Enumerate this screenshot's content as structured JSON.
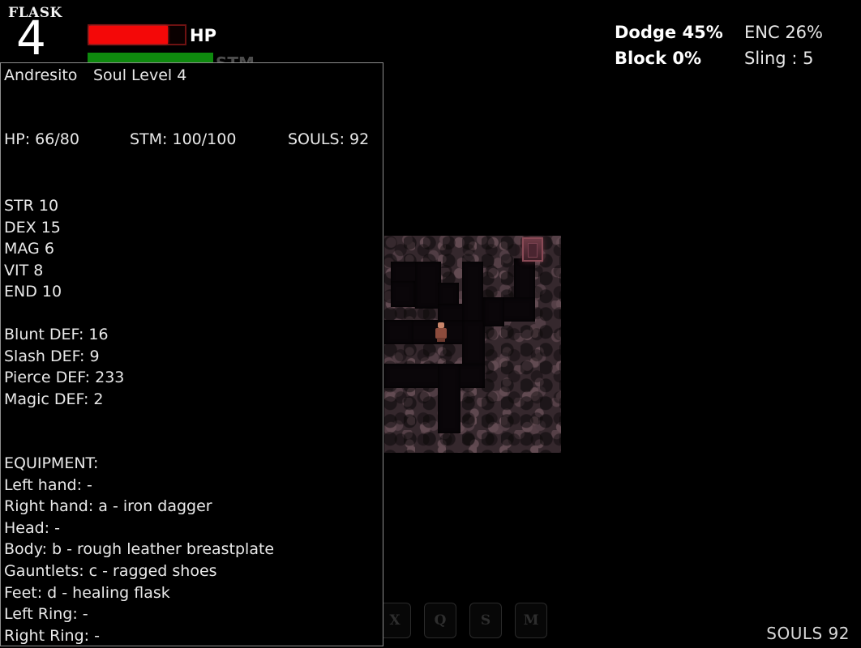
{
  "hud": {
    "flask_label": "FLASK",
    "flask_count": "4",
    "hp_tag": "HP",
    "stm_tag": "STM",
    "hp_percent": 82,
    "stm_percent": 100,
    "dodge_label": "Dodge 45%",
    "enc_label": "ENC 26%",
    "block_label": "Block  0%",
    "sling_label": "Sling : 5",
    "souls_footer": "SOULS 92",
    "keys": [
      "",
      "X",
      "Q",
      "S",
      "M"
    ],
    "colors": {
      "hp_fill": "#f40808",
      "hp_border": "#6e1212",
      "stm_fill": "#0e8a0e",
      "panel_border": "#8d8d8d",
      "text": "#e9e9e9"
    }
  },
  "map": {
    "player_name": "player-sprite",
    "door_name": "dungeon-door"
  },
  "sheet": {
    "character_name": "Andresito",
    "soul_level": "Soul Level 4",
    "hp": "HP: 66/80",
    "stm": "STM: 100/100",
    "souls": "SOULS: 92",
    "attributes": [
      "STR 10",
      "DEX 15",
      "MAG 6",
      "VIT 8",
      "END 10"
    ],
    "defenses": [
      "Blunt DEF: 16",
      "Slash DEF: 9",
      "Pierce DEF: 233",
      "Magic DEF: 2"
    ],
    "equipment_title": "EQUIPMENT:",
    "equipment": [
      "Left hand: -",
      "Right hand: a - iron dagger",
      "Head: -",
      "Body: b - rough leather breastplate",
      "Gauntlets: c - ragged shoes",
      "Feet: d - healing flask",
      "Left Ring: -",
      "Right Ring: -"
    ]
  }
}
